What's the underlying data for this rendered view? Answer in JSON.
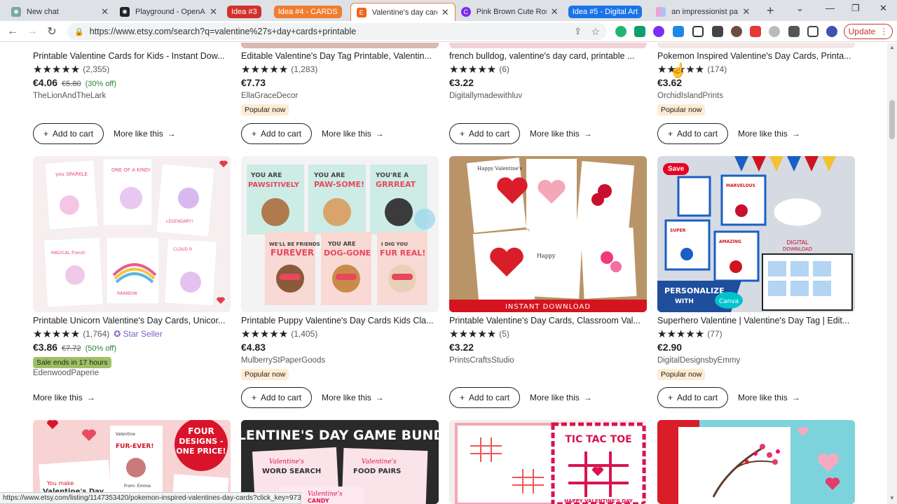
{
  "browser": {
    "tabs": [
      {
        "label": "New chat",
        "favicon_color": "#74aa9c"
      },
      {
        "label": "Playground - OpenAI API",
        "favicon_color": "#222222"
      },
      {
        "group": "Idea #3",
        "group_color": "#d0312d"
      },
      {
        "group": "Idea #4 - CARDS",
        "group_color": "#ef7e2e"
      },
      {
        "label": "Valentine's day cards printable",
        "favicon_color": "#f1641e",
        "active": true
      },
      {
        "label": "Pink Brown Cute Romantic",
        "favicon_color": "#7d2ae8"
      },
      {
        "group": "Idea #5 - Digital Art",
        "group_color": "#1a73e8"
      },
      {
        "label": "an impressionist painting",
        "favicon_color": "#c5a3ff"
      }
    ],
    "url": "https://www.etsy.com/search?q=valentine%27s+day+cards+printable",
    "update_label": "Update",
    "status_url": "https://www.etsy.com/listing/1147353420/pokemon-inspired-valentines-day-cards?click_key=973..."
  },
  "labels": {
    "add_to_cart": "Add to cart",
    "more_like_this": "More like this"
  },
  "row1": [
    {
      "title": "Printable Valentine Cards for Kids - Instant Dow...",
      "stars": "★★★★★",
      "reviews": "(2,355)",
      "price": "€4.06",
      "old_price": "€5.80",
      "discount": "(30% off)",
      "shop": "TheLionAndTheLark",
      "badge": ""
    },
    {
      "title": "Editable Valentine's Day Tag Printable, Valentin...",
      "stars": "★★★★★",
      "reviews": "(1,283)",
      "price": "€7.73",
      "old_price": "",
      "discount": "",
      "shop": "EllaGraceDecor",
      "badge": "Popular now"
    },
    {
      "title": "french bulldog, valentine's day card, printable ...",
      "stars": "★★★★★",
      "reviews": "(6)",
      "price": "€3.22",
      "old_price": "",
      "discount": "",
      "shop": "Digitallymadewithluv",
      "badge": ""
    },
    {
      "title": "Pokemon Inspired Valentine's Day Cards, Printa...",
      "stars": "★★★★★",
      "reviews": "(174)",
      "price": "€3.62",
      "old_price": "",
      "discount": "",
      "shop": "OrchidIslandPrints",
      "badge": "Popular now"
    }
  ],
  "row2": [
    {
      "title": "Printable Unicorn Valentine's Day Cards, Unicor...",
      "stars": "★★★★★",
      "reviews": "(1,764)",
      "star_seller": "Star Seller",
      "price": "€3.86",
      "old_price": "€7.72",
      "discount": "(50% off)",
      "sale": "Sale ends in 17 hours",
      "shop": "EdenwoodPaperie",
      "badge": ""
    },
    {
      "title": "Printable Puppy Valentine's Day Cards Kids Cla...",
      "stars": "★★★★★",
      "reviews": "(1,405)",
      "price": "€4.83",
      "shop": "MulberryStPaperGoods",
      "badge": "Popular now"
    },
    {
      "title": "Printable Valentine's Day Cards, Classroom Val...",
      "stars": "★★★★★",
      "reviews": "(5)",
      "price": "€3.22",
      "shop": "PrintsCraftsStudio",
      "badge": ""
    },
    {
      "title": "Superhero Valentine | Valentine's Day Tag | Edit...",
      "stars": "★★★★★",
      "reviews": "(77)",
      "price": "€2.90",
      "shop": "DigitalDesignsbyEmmy",
      "badge": "Popular now"
    }
  ],
  "images": {
    "unicorn": [
      "you SPARKLE valentine!",
      "you are ONE OF A KIND!",
      "friends like you are LEGENDARY!",
      "you are a MAGICAL friend!",
      "I'm over the RAINBOW for you!",
      "I'm on CLOUD 9 with you!"
    ],
    "puppy": [
      "YOU ARE PAWSITIVELY AMAZING",
      "YOU ARE PAW-SOME!",
      "YOU'RE A GRRREAT FRIEND!",
      "WE'LL BE FRIENDS FUREVER",
      "YOU ARE DOG-GONE GREAT",
      "I DIG YOU FUR REAL!"
    ],
    "classroom": [
      "Happy Valentine's Day!",
      "INSTANT DOWNLOAD"
    ],
    "superhero": [
      "HAVE A MARVELOUS VALENTINE'S DAY",
      "HAVE A SUPER VALENTINE'S DAY",
      "HAVE AN AMAZING VALENTINE'S DAY",
      "PERSONALIZE WITH",
      "Canva",
      "DIGITAL DOWNLOAD",
      "Save"
    ],
    "row3_1": [
      "FOUR DESIGNS - ONE PRICE!",
      "You make Valentine's Day",
      "Valentine Hope we're friends FUR-EVER!",
      "From: Emma"
    ],
    "row3_2": [
      "VALENTINE'S DAY GAME BUNDLE",
      "Valentine's WORD SEARCH",
      "Valentine's FOOD PAIRS",
      "Valentine's CANDY"
    ],
    "row3_3": [
      "TIC TAC TOE",
      "HAPPY VALENTINE'S DAY"
    ]
  },
  "colors": {
    "etsy_orange": "#f1641e",
    "sale_green": "#9ec063",
    "popular_bg": "#fdebd2",
    "star_seller": "#7c5cc4"
  }
}
